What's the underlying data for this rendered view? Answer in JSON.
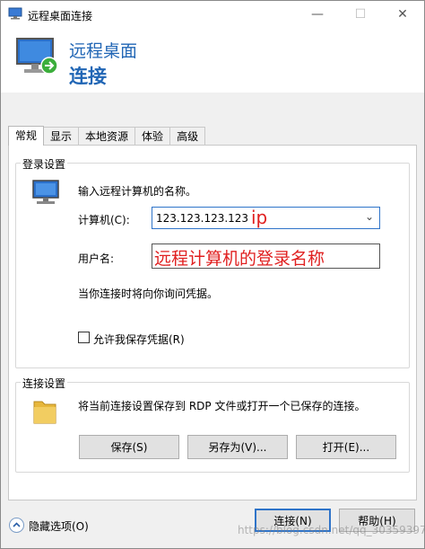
{
  "window": {
    "title": "远程桌面连接",
    "minimize": "—",
    "maximize": "☐",
    "close": "✕"
  },
  "header": {
    "line1": "远程桌面",
    "line2": "连接"
  },
  "tabs": [
    {
      "label": "常规",
      "active": true
    },
    {
      "label": "显示"
    },
    {
      "label": "本地资源"
    },
    {
      "label": "体验"
    },
    {
      "label": "高级"
    }
  ],
  "login": {
    "group_label": "登录设置",
    "prompt": "输入远程计算机的名称。",
    "computer_label": "计算机(C):",
    "computer_value": "123.123.123.123",
    "ip_annotation": "ip",
    "username_label": "用户名:",
    "username_annotation": "远程计算机的登录名称",
    "credentials_note": "当你连接时将向你询问凭据。",
    "save_credentials_label": "允许我保存凭据(R)",
    "save_credentials_checked": false
  },
  "connection": {
    "group_label": "连接设置",
    "description": "将当前连接设置保存到 RDP 文件或打开一个已保存的连接。",
    "save_button": "保存(S)",
    "save_as_button": "另存为(V)...",
    "open_button": "打开(E)..."
  },
  "footer": {
    "hide_options": "隐藏选项(O)",
    "connect_button": "连接(N)",
    "help_button": "帮助(H)",
    "watermark": "https://blog.csdn.net/qq_30359397"
  }
}
